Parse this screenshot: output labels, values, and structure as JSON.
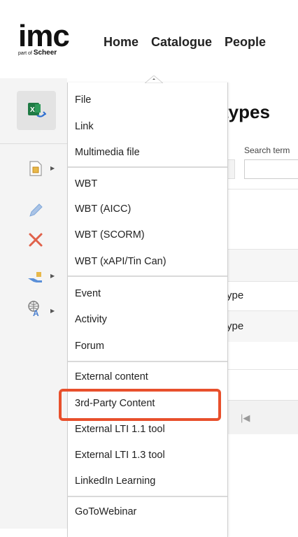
{
  "header": {
    "logo_text": "imc",
    "logo_sub_small": "part of",
    "logo_sub_brand": "Scheer",
    "nav": [
      "Home",
      "Catalogue",
      "People"
    ]
  },
  "page": {
    "title_fragment": "types",
    "search_label": "Search term",
    "rows": [
      "ype",
      "ype"
    ],
    "pager_first": "|◀"
  },
  "menu": {
    "groups": [
      [
        "File",
        "Link",
        "Multimedia file"
      ],
      [
        "WBT",
        "WBT (AICC)",
        "WBT (SCORM)",
        "WBT (xAPI/Tin Can)"
      ],
      [
        "Event",
        "Activity",
        "Forum"
      ],
      [
        "External content",
        "3rd-Party Content",
        "External LTI 1.1 tool",
        "External LTI 1.3 tool",
        "LinkedIn Learning"
      ],
      [
        "GoToWebinar"
      ]
    ],
    "highlighted": "3rd-Party Content"
  },
  "icons": {
    "excel": "excel-export-icon",
    "new_object": "new-object-icon",
    "edit": "pencil-icon",
    "delete": "delete-x-icon",
    "share": "hand-share-icon",
    "translate": "translate-icon"
  },
  "colors": {
    "highlight_border": "#e8502c",
    "delete_red": "#e0614a",
    "edit_blue": "#7ea6d8",
    "excel_green": "#1f7a44"
  }
}
